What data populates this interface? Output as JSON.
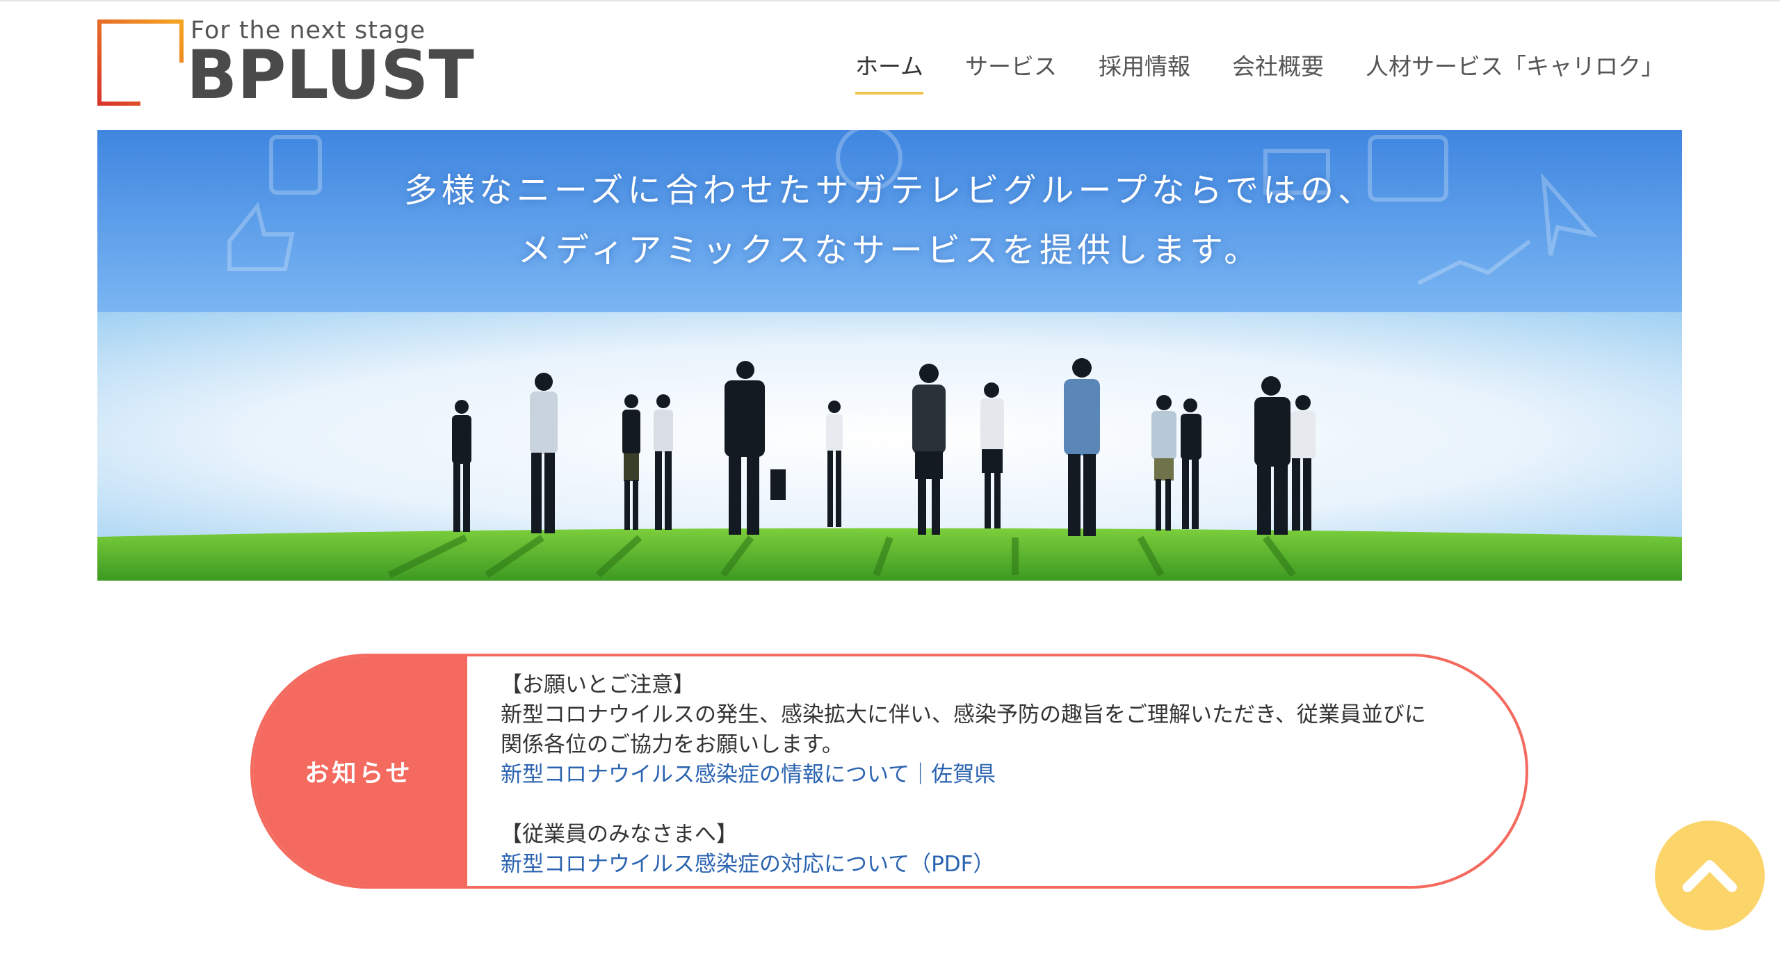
{
  "header": {
    "logo_tagline": "For the next stage",
    "logo_name": "BPLUST"
  },
  "nav": {
    "items": [
      {
        "label": "ホーム",
        "active": true
      },
      {
        "label": "サービス"
      },
      {
        "label": "採用情報"
      },
      {
        "label": "会社概要"
      },
      {
        "label": "人材サービス「キャリロク」"
      }
    ]
  },
  "hero": {
    "line1": "多様なニーズに合わせたサガテレビグループならではの、",
    "line2": "メディアミックスなサービスを提供します。"
  },
  "notice": {
    "label": "お知らせ",
    "heading1": "【お願いとご注意】",
    "text1a": "新型コロナウイルスの発生、感染拡大に伴い、感染予防の趣旨をご理解いただき、従業員並びに",
    "text1b": "関係各位のご協力をお願いします。",
    "link1": "新型コロナウイルス感染症の情報について｜佐賀県",
    "heading2": "【従業員のみなさまへ】",
    "link2": "新型コロナウイルス感染症の対応について（PDF）"
  },
  "colors": {
    "accent_red": "#f46a5f",
    "accent_yellow": "#fbd46a",
    "link_blue": "#2a63b0"
  },
  "icons": {
    "scroll_top": "chevron-up-icon"
  }
}
